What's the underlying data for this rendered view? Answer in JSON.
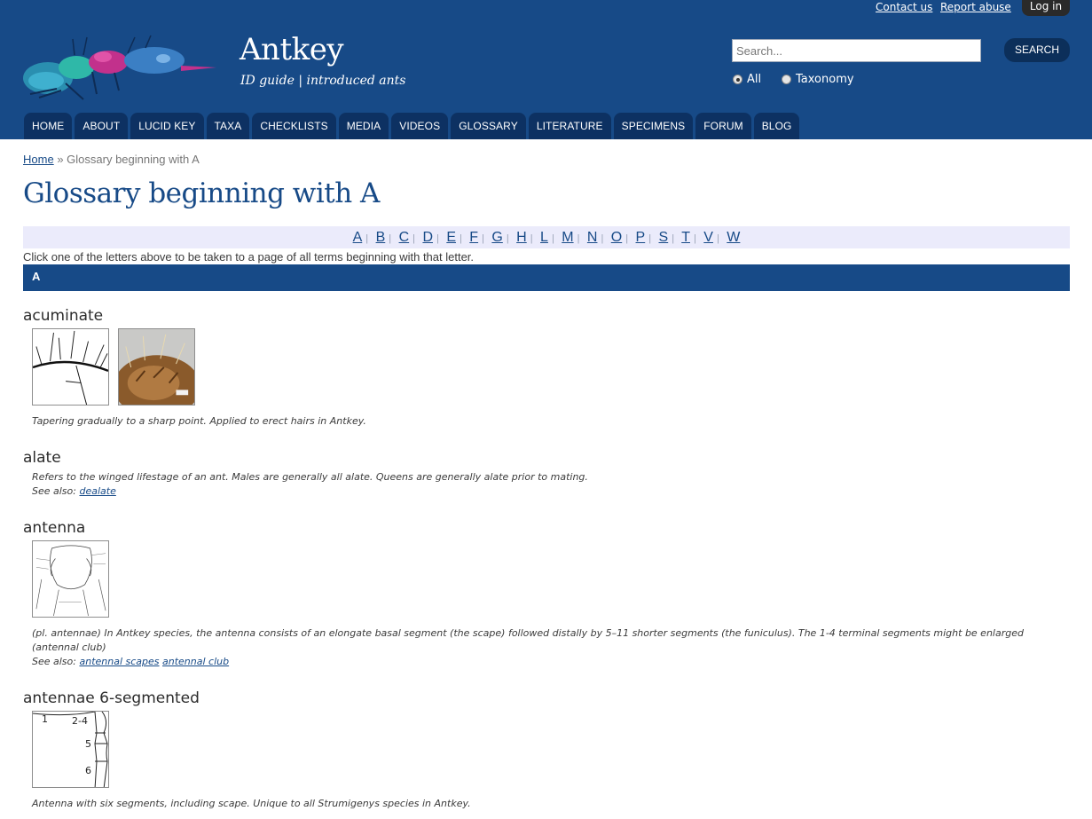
{
  "header": {
    "contact_link": "Contact us",
    "report_link": "Report abuse",
    "login_button": "Log in",
    "site_name": "Antkey",
    "site_slogan": "ID guide | introduced ants",
    "search": {
      "placeholder": "Search...",
      "button": "SEARCH"
    },
    "search_scope": [
      {
        "label": "All",
        "checked": true
      },
      {
        "label": "Taxonomy",
        "checked": false
      }
    ],
    "menu": [
      "HOME",
      "ABOUT",
      "LUCID KEY",
      "TAXA",
      "CHECKLISTS",
      "MEDIA",
      "VIDEOS",
      "GLOSSARY",
      "LITERATURE",
      "SPECIMENS",
      "FORUM",
      "BLOG"
    ]
  },
  "breadcrumb": {
    "home": "Home",
    "separator": "»",
    "current": "Glossary beginning with A"
  },
  "page_title": "Glossary beginning with A",
  "alphabet": [
    "A",
    "B",
    "C",
    "D",
    "E",
    "F",
    "G",
    "H",
    "L",
    "M",
    "N",
    "O",
    "P",
    "S",
    "T",
    "V",
    "W"
  ],
  "alphabet_hint": "Click one of the letters above to be taken to a page of all terms beginning with that letter.",
  "letter_heading": "A",
  "entries": [
    {
      "term": "acuminate",
      "description": "Tapering gradually to a sharp point. Applied to erect hairs in Antkey."
    },
    {
      "term": "alate",
      "description": "Refers to the winged lifestage of an ant. Males are generally all alate. Queens are generally alate prior to mating.",
      "see_also_label": "See also:",
      "see_also": [
        "dealate"
      ]
    },
    {
      "term": "antenna",
      "description": "(pl. antennae) In Antkey species, the antenna consists of an elongate basal segment (the scape) followed distally by 5–11 shorter segments (the funiculus). The 1-4 terminal segments might be enlarged (antennal club)",
      "see_also_label": "See also:",
      "see_also": [
        "antennal scapes",
        "antennal club"
      ]
    },
    {
      "term": "antennae 6-segmented",
      "description": "Antenna with six segments, including scape. Unique to all Strumigenys species in Antkey.",
      "figure_labels": [
        "1",
        "2-4",
        "5",
        "6"
      ]
    }
  ],
  "colors": {
    "brand_blue": "#174a87",
    "menu_tab": "#0d3162",
    "alpha_bar_bg": "#ebebfb"
  }
}
